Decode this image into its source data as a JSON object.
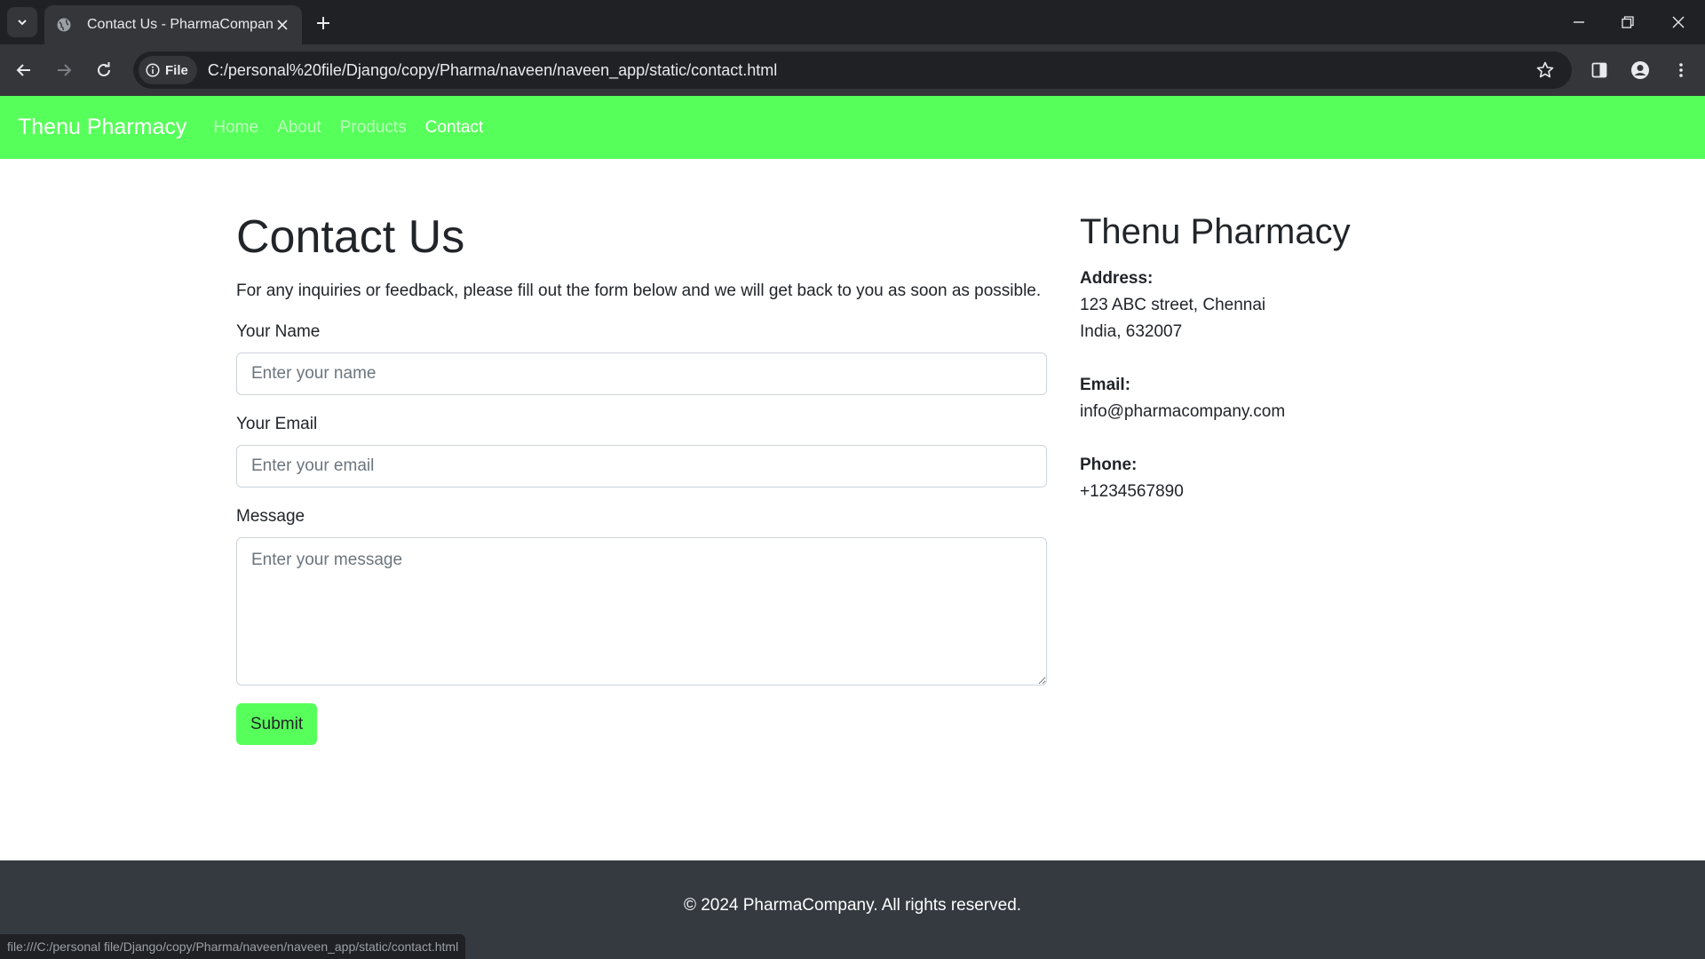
{
  "browser": {
    "tab_title": "Contact Us - PharmaCompany",
    "file_chip": "File",
    "url": "C:/personal%20file/Django/copy/Pharma/naveen/naveen_app/static/contact.html",
    "status_url": "file:///C:/personal file/Django/copy/Pharma/naveen/naveen_app/static/contact.html"
  },
  "navbar": {
    "brand": "Thenu Pharmacy",
    "links": [
      "Home",
      "About",
      "Products",
      "Contact"
    ],
    "active": "Contact",
    "color": "#57ff5a"
  },
  "contact": {
    "title": "Contact Us",
    "lead": "For any inquiries or feedback, please fill out the form below and we will get back to you as soon as possible.",
    "name_label": "Your Name",
    "name_placeholder": "Enter your name",
    "email_label": "Your Email",
    "email_placeholder": "Enter your email",
    "message_label": "Message",
    "message_placeholder": "Enter your message",
    "submit_label": "Submit"
  },
  "sidebar": {
    "title": "Thenu Pharmacy",
    "address_label": "Address:",
    "address_line1": "123 ABC street, Chennai",
    "address_line2": "India, 632007",
    "email_label": "Email:",
    "email_value": "info@pharmacompany.com",
    "phone_label": "Phone:",
    "phone_value": "+1234567890"
  },
  "footer": {
    "text": "© 2024 PharmaCompany. All rights reserved."
  }
}
